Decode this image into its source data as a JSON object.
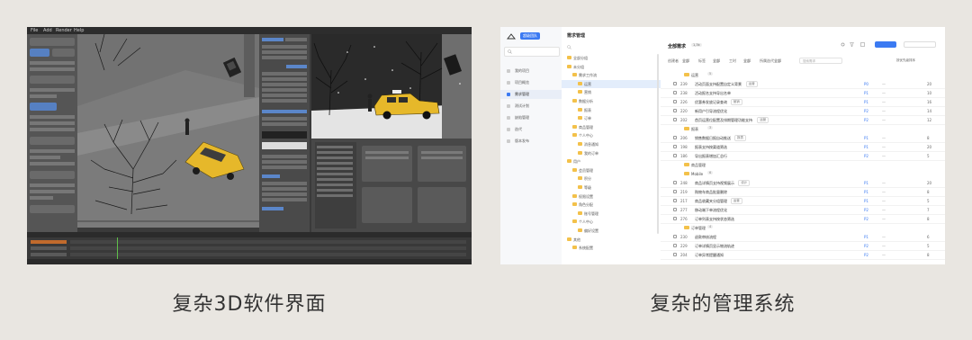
{
  "captions": {
    "left": "复杂3D软件界面",
    "right": "复杂的管理系统"
  },
  "software3d": {
    "menu": [
      "File",
      "Add",
      "Render",
      "Help"
    ]
  },
  "manager": {
    "nav": [
      "我的项目",
      "项目概览",
      "需求管理",
      "测试计划",
      "缺陷管理",
      "迭代",
      "版本发布"
    ],
    "active_nav_index": 2,
    "team_label": "超级团队",
    "header_title": "需求管理",
    "all_requirements": "全部需求",
    "total_count": "1,3k",
    "tree": [
      {
        "label": "全部分组",
        "level": 0,
        "selected": false
      },
      {
        "label": "未分组",
        "level": 0,
        "selected": false
      },
      {
        "label": "需求工作流",
        "level": 1,
        "selected": false
      },
      {
        "label": "运营",
        "level": 2,
        "selected": true
      },
      {
        "label": "营销",
        "level": 2,
        "selected": false
      },
      {
        "label": "数据分析",
        "level": 1,
        "selected": false
      },
      {
        "label": "报表",
        "level": 2,
        "selected": false
      },
      {
        "label": "订单",
        "level": 2,
        "selected": false
      },
      {
        "label": "商品管理",
        "level": 1,
        "selected": false
      },
      {
        "label": "个人中心",
        "level": 1,
        "selected": false
      },
      {
        "label": "消息通知",
        "level": 2,
        "selected": false
      },
      {
        "label": "我的订单",
        "level": 2,
        "selected": false
      },
      {
        "label": "用户",
        "level": 0,
        "selected": false
      },
      {
        "label": "会员管理",
        "level": 1,
        "selected": false
      },
      {
        "label": "积分",
        "level": 2,
        "selected": false
      },
      {
        "label": "等级",
        "level": 2,
        "selected": false
      },
      {
        "label": "权限设置",
        "level": 1,
        "selected": false
      },
      {
        "label": "角色分配",
        "level": 1,
        "selected": false
      },
      {
        "label": "账号管理",
        "level": 2,
        "selected": false
      },
      {
        "label": "个人中心",
        "level": 1,
        "selected": false
      },
      {
        "label": "偏好设置",
        "level": 2,
        "selected": false
      },
      {
        "label": "其他",
        "level": 0,
        "selected": false
      },
      {
        "label": "系统配置",
        "level": 1,
        "selected": false
      }
    ],
    "filters": [
      "创建者",
      "标签",
      "工时",
      "所属迭代"
    ],
    "filter_value": "全部",
    "search_placeholder": "搜索需求",
    "sort_label": "按优先级排序",
    "groups": [
      {
        "name": "运营",
        "count": "5",
        "rows": [
          {
            "id": "239",
            "title": "活动页面支持配置自定义背景",
            "tag": "运营",
            "priority": "P0",
            "status": "—",
            "points": "20"
          },
          {
            "id": "238",
            "title": "活动报名支持导出名单",
            "tag": "",
            "priority": "P1",
            "status": "—",
            "points": "10"
          },
          {
            "id": "226",
            "title": "优惠券发放记录查询",
            "tag": "营销",
            "priority": "P1",
            "status": "—",
            "points": "16"
          },
          {
            "id": "220",
            "title": "新用户引导流程优化",
            "tag": "",
            "priority": "P2",
            "status": "—",
            "points": "14"
          },
          {
            "id": "202",
            "title": "首页运营位配置及排期管理功能支持",
            "tag": "运营",
            "priority": "P2",
            "status": "—",
            "points": "12"
          }
        ]
      },
      {
        "name": "报表",
        "count": "3",
        "rows": [
          {
            "id": "206",
            "title": "销售数据日报自动推送",
            "tag": "报表",
            "priority": "P1",
            "status": "—",
            "points": "8"
          },
          {
            "id": "198",
            "title": "报表支持按渠道筛选",
            "tag": "",
            "priority": "P1",
            "status": "—",
            "points": "20"
          },
          {
            "id": "186",
            "title": "导出报表增加汇总行",
            "tag": "",
            "priority": "P2",
            "status": "—",
            "points": "5"
          }
        ]
      },
      {
        "name": "商品管理",
        "count": "",
        "rows": []
      },
      {
        "name": "Mobile",
        "count": "6",
        "rows": [
          {
            "id": "248",
            "title": "商品详情页支持视频展示",
            "tag": "设计",
            "priority": "P1",
            "status": "—",
            "points": "20"
          },
          {
            "id": "219",
            "title": "购物车商品批量删除",
            "tag": "",
            "priority": "P1",
            "status": "—",
            "points": "8"
          },
          {
            "id": "217",
            "title": "商品收藏夹分组管理",
            "tag": "运营",
            "priority": "P1",
            "status": "—",
            "points": "5"
          },
          {
            "id": "277",
            "title": "移动端下单流程优化",
            "tag": "",
            "priority": "P2",
            "status": "—",
            "points": "7"
          },
          {
            "id": "276",
            "title": "订单列表支持按状态筛选",
            "tag": "",
            "priority": "P2",
            "status": "—",
            "points": "8"
          }
        ]
      },
      {
        "name": "订单管理",
        "count": "4",
        "rows": [
          {
            "id": "230",
            "title": "退款审核流程",
            "tag": "",
            "priority": "P1",
            "status": "—",
            "points": "6"
          },
          {
            "id": "229",
            "title": "订单详情页显示物流轨迹",
            "tag": "",
            "priority": "P2",
            "status": "—",
            "points": "5"
          },
          {
            "id": "204",
            "title": "订单异常提醒通知",
            "tag": "",
            "priority": "P2",
            "status": "—",
            "points": "8"
          },
          {
            "id": "200",
            "title": "订单导出支持自定义字段",
            "tag": "订单",
            "priority": "P3",
            "status": "—",
            "points": "5"
          }
        ]
      }
    ]
  },
  "colors": {
    "accent": "#3b7af2",
    "folder": "#f3c14a",
    "taxi": "#e6b82a",
    "blender_blue": "#5680c2"
  }
}
